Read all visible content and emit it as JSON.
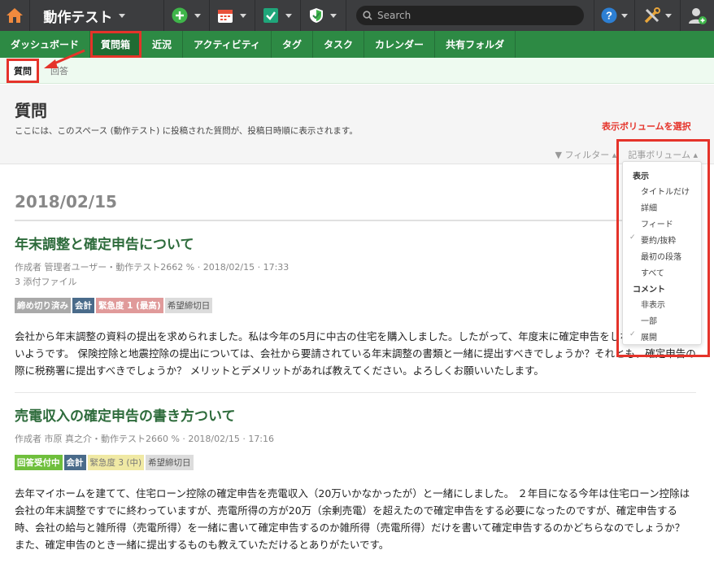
{
  "topbar": {
    "space_title": "動作テスト",
    "search_placeholder": "Search",
    "icons": [
      "home-icon",
      "plus-icon",
      "calendar-icon",
      "check-icon",
      "shield-icon",
      "help-icon",
      "tools-icon",
      "user-add-icon"
    ],
    "help_label": "?"
  },
  "nav": {
    "items": [
      {
        "label": "ダッシュボード"
      },
      {
        "label": "質問箱"
      },
      {
        "label": "近況"
      },
      {
        "label": "アクティビティ"
      },
      {
        "label": "タグ"
      },
      {
        "label": "タスク"
      },
      {
        "label": "カレンダー"
      },
      {
        "label": "共有フォルダ"
      }
    ],
    "active": "質問箱"
  },
  "subnav": {
    "items": [
      {
        "label": "質問"
      },
      {
        "label": "回答"
      }
    ],
    "active": "質問"
  },
  "header": {
    "title": "質問",
    "description": "ここには、このスペース (動作テスト) に投稿された質問が、投稿日時順に表示されます。",
    "filter_label": "フィルター",
    "volume_label": "記事ボリューム"
  },
  "callout": "表示ボリュームを選択",
  "dropdown": {
    "section1": "表示",
    "options1": [
      {
        "label": "タイトルだけ",
        "checked": false
      },
      {
        "label": "詳細",
        "checked": false
      },
      {
        "label": "フィード",
        "checked": false
      },
      {
        "label": "要約/抜粋",
        "checked": true
      },
      {
        "label": "最初の段落",
        "checked": false
      },
      {
        "label": "すべて",
        "checked": false
      }
    ],
    "section2": "コメント",
    "options2": [
      {
        "label": "非表示",
        "checked": false
      },
      {
        "label": "一部",
        "checked": false
      },
      {
        "label": "展開",
        "checked": true
      }
    ]
  },
  "content": {
    "date": "2018/02/15",
    "posts": [
      {
        "title": "年末調整と確定申告について",
        "meta": "作成者 管理者ユーザー・動作テスト2662 % · 2018/02/15 · 17:33",
        "attachments": "3 添付ファイル",
        "tags": [
          {
            "label": "締め切り済み",
            "color": "#a9a9a9"
          },
          {
            "label": "会計",
            "color": "#4a6b8a"
          },
          {
            "label": "緊急度 1 (最高)",
            "color": "#e09a9a"
          },
          {
            "label": "希望締切日",
            "color": "#dcdcdc"
          }
        ],
        "body": "会社から年末調整の資料の提出を求められました。私は今年の5月に中古の住宅を購入しました。したがって、年度末に確定申告をしなければならないようです。 保険控除と地震控除の提出については、会社から要請されている年末調整の書類と一緒に提出すべきでしょうか？それとも、確定申告の際に税務署に提出すべきでしょうか？ メリットとデメリットがあれば教えてください。よろしくお願いいたします。"
      },
      {
        "title": "売電収入の確定申告の書き方ついて",
        "meta": "作成者 市原 真之介・動作テスト2660 % · 2018/02/15 · 17:16",
        "attachments": "",
        "tags": [
          {
            "label": "回答受付中",
            "color": "#6fbf3c"
          },
          {
            "label": "会計",
            "color": "#4a6b8a"
          },
          {
            "label": "緊急度 3 (中)",
            "color": "#f0e9a4"
          },
          {
            "label": "希望締切日",
            "color": "#dcdcdc"
          }
        ],
        "body": "去年マイホームを建てて、住宅ローン控除の確定申告を売電収入（20万いかなかったが）と一緒にしました。 ２年目になる今年は住宅ローン控除は会社の年末調整ですでに終わっていますが、売電所得の方が20万（余剰売電）を超えたので確定申告をする必要になったのですが、確定申告する時、会社の給与と雑所得（売電所得）を一緒に書いて確定申告するのか雑所得（売電所得）だけを書いて確定申告するのかどちらなのでしょうか？ また、確定申告のとき一緒に提出するものも教えていただけるとありがたいです。"
      }
    ]
  }
}
